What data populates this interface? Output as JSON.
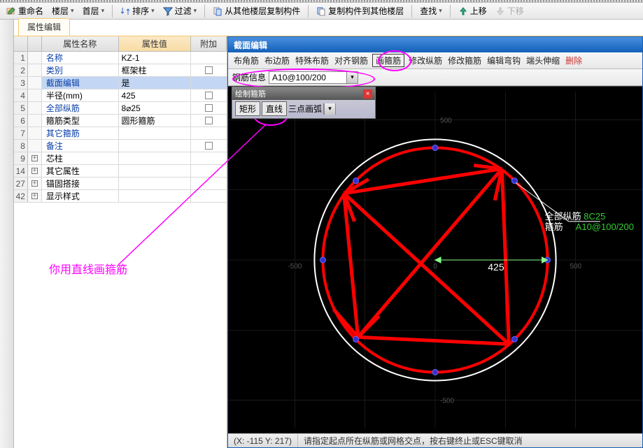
{
  "toolbar": {
    "rename": "重命名",
    "floor": "楼层",
    "first_floor": "首层",
    "sort": "排序",
    "filter": "过滤",
    "copy_from": "从其他楼层复制构件",
    "copy_to": "复制构件到其他楼层",
    "find": "查找",
    "move_up": "上移",
    "move_down": "下移"
  },
  "tab": {
    "property_edit": "属性编辑"
  },
  "grid": {
    "hdr_name": "属性名称",
    "hdr_value": "属性值",
    "hdr_add": "附加",
    "rows": [
      {
        "num": "1",
        "name": "名称",
        "val": "KZ-1",
        "link": true,
        "add": false,
        "exp": ""
      },
      {
        "num": "2",
        "name": "类别",
        "val": "框架柱",
        "link": true,
        "add": true,
        "exp": ""
      },
      {
        "num": "3",
        "name": "截面编辑",
        "val": "是",
        "link": true,
        "add": false,
        "sel": true,
        "exp": ""
      },
      {
        "num": "4",
        "name": "半径(mm)",
        "val": "425",
        "link": false,
        "add": true,
        "exp": ""
      },
      {
        "num": "5",
        "name": "全部纵筋",
        "val": "8⌀25",
        "link": true,
        "add": true,
        "exp": ""
      },
      {
        "num": "6",
        "name": "箍筋类型",
        "val": "圆形箍筋",
        "link": false,
        "add": true,
        "exp": ""
      },
      {
        "num": "7",
        "name": "其它箍筋",
        "val": "",
        "link": true,
        "add": false,
        "exp": ""
      },
      {
        "num": "8",
        "name": "备注",
        "val": "",
        "link": true,
        "add": true,
        "exp": ""
      },
      {
        "num": "9",
        "name": "芯柱",
        "val": "",
        "link": false,
        "add": false,
        "exp": "+"
      },
      {
        "num": "14",
        "name": "其它属性",
        "val": "",
        "link": false,
        "add": false,
        "exp": "+"
      },
      {
        "num": "27",
        "name": "锚固搭接",
        "val": "",
        "link": false,
        "add": false,
        "exp": "+"
      },
      {
        "num": "42",
        "name": "显示样式",
        "val": "",
        "link": false,
        "add": false,
        "exp": "+"
      }
    ]
  },
  "annotation": "你用直线画箍筋",
  "editor": {
    "title": "截面编辑",
    "menu": [
      "布角筋",
      "布边筋",
      "特殊布筋",
      "对齐钢筋",
      "画箍筋",
      "修改纵筋",
      "修改箍筋",
      "编辑弯钩",
      "端头伸缩"
    ],
    "menu_del": "删除",
    "info_label": "钢筋信息",
    "info_value": "A10@100/200",
    "draw_tb_title": "绘制箍筋",
    "draw_rect": "矩形",
    "draw_line": "直线",
    "draw_arc": "三点画弧",
    "label_all": "全部纵筋",
    "label_all_val": "8C25",
    "label_stirrup": "箍筋",
    "label_stirrup_val": "A10@100/200",
    "radius": "425"
  },
  "status": {
    "coord": "(X: -115 Y: 217)",
    "msg": "请指定起点所在纵筋或网格交点，按右键终止或ESC键取消"
  }
}
